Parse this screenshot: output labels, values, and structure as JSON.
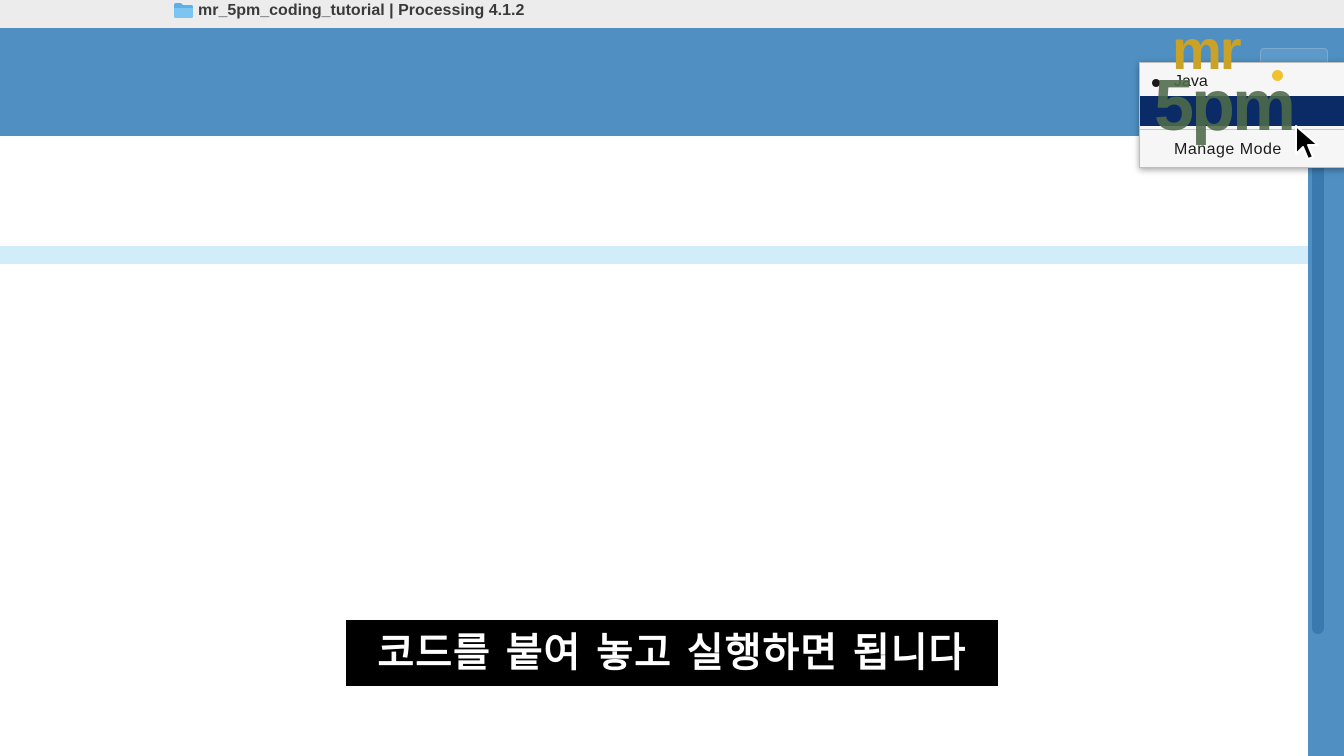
{
  "window": {
    "title": "mr_5pm_coding_tutorial | Processing 4.1.2"
  },
  "mode_menu": {
    "items": [
      {
        "label": "Java",
        "checked": true
      },
      {
        "label": "",
        "highlighted": true
      }
    ],
    "manage_label": "Manage Mode"
  },
  "watermark": {
    "line1": "mr",
    "line2": "5pm"
  },
  "caption": {
    "text": "코드를 붙여 놓고 실행하면 됩니다"
  },
  "colors": {
    "toolbar": "#4f8fc1",
    "line_highlight": "#d1edf9",
    "menu_selection": "#0b2b66",
    "caption_bg": "#000000"
  }
}
